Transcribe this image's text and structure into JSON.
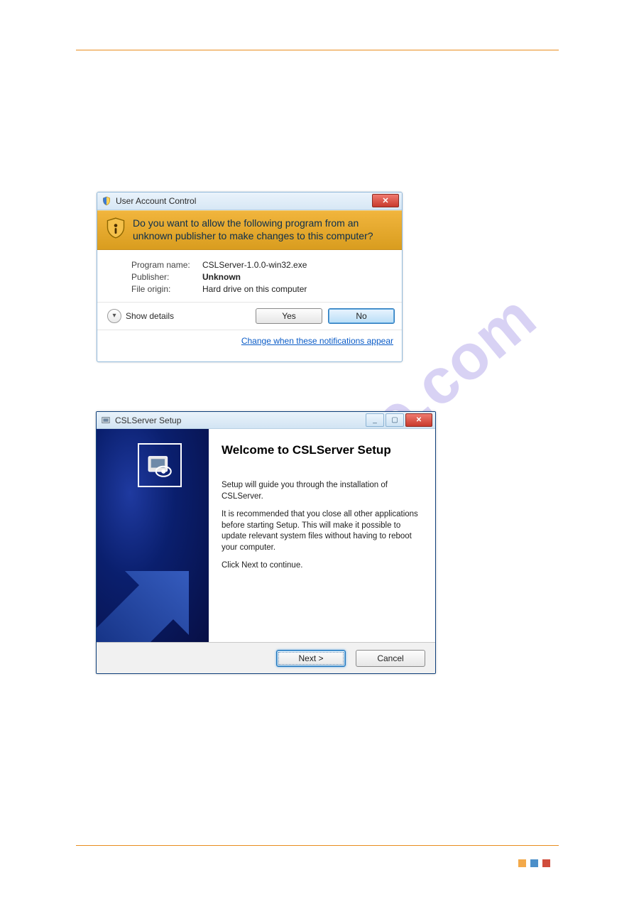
{
  "watermark_text": "manualshive.com",
  "uac": {
    "title": "User Account Control",
    "banner": "Do you want to allow the following program from an unknown publisher to make changes to this computer?",
    "labels": {
      "program_name": "Program name:",
      "publisher": "Publisher:",
      "file_origin": "File origin:"
    },
    "values": {
      "program_name": "CSLServer-1.0.0-win32.exe",
      "publisher": "Unknown",
      "file_origin": "Hard drive on this computer"
    },
    "show_details": "Show details",
    "yes": "Yes",
    "no": "No",
    "change_link": "Change when these notifications appear"
  },
  "wizard": {
    "title": "CSLServer Setup",
    "heading": "Welcome to CSLServer Setup",
    "p1": "Setup will guide you through the installation of CSLServer.",
    "p2": "It is recommended that you close all other applications before starting Setup. This will make it possible to update relevant system files without having to reboot your computer.",
    "p3": "Click Next to continue.",
    "next": "Next >",
    "cancel": "Cancel"
  }
}
